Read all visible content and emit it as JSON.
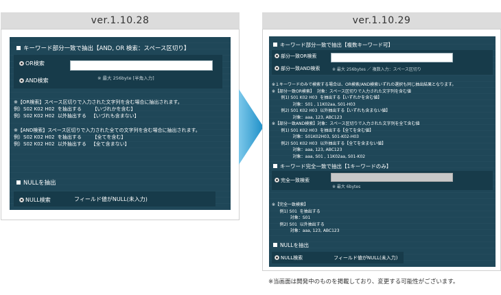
{
  "left": {
    "version": "ver.1.10.28",
    "section_keyword": "キーワード部分一致で抽出【AND, OR 検索：スペース区切り】",
    "or_label": "OR検索",
    "and_label": "AND検索",
    "input_value": "",
    "hint": "※ 最大 256byte [半角入力]",
    "explain": "※【OR検索】スペース区切りで入力された文字列を含む場合に抽出されます。\n例）S02 K02 H02  を抽出する       【いづれかを含む】\n例）S02 K02 H02  以外抽出する   【いづれも含まない】\n\n※【AND検索】スペース区切りで入力された全ての文字列を含む場合に抽出されます。\n例）S02 K02 H02  を抽出する       【全てを含む】\n例）S02 K02 H02  以外抽出する   【全て含まない】",
    "section_null": "NULLを抽出",
    "null_label": "NULL検索",
    "null_desc": "フィールド値がNULL(未入力)"
  },
  "right": {
    "version": "ver.1.10.29",
    "section_partial": "キーワード部分一致で抽出【複数キーワード可】",
    "partial_or_label": "部分一致OR検索",
    "partial_and_label": "部分一致AND検索",
    "partial_input_value": "",
    "partial_hint": "※ 最大 256bytes ／ 複数入力：スペース区切り",
    "partial_explain": "※１キーワードのみで検索する場合は、OR検索/AND検索いずれの選択も同じ抽出結果となります。\n※【部分一致OR検索】  対象：スペース区切りで入力された文字列を含む値\n       例1) S01 K02 H03  を抽出する【いずれかを含む値】\n                対象：S01 , 11K02aa, S01-H03\n       例2) S01 K02 H03  以外抽出する【いずれも含まない値】\n                対象：aaa, 123, ABC123\n※【部分一致AND検索】対象：スペース区切りで入力された文字列を全て含む値\n       例1) S01 K02 H03  を抽出する【全てを含む値】\n                対象：S01K02H03, S01-K02-H03\n       例2) S01 K02 H03  以外抽出する【全てを含まない値】\n                対象：aaa, 123, ABC123\n                対象：aaa, S01 , 11K02aa, S01-K02",
    "section_exact": "キーワード完全一致で抽出【1キーワードのみ】",
    "exact_label": "完全一致検索",
    "exact_input_value": "",
    "exact_hint": "※ 最大 6bytes",
    "exact_explain": "※【完全一致検索】\n      例1) S01  を抽出する\n              対象：S01\n      例2) S01  以外抽出する\n              対象：aaa, 123, ABC123",
    "section_null": "NULLを抽出",
    "null_label": "NULL検索",
    "null_desc": "フィールド値がNULL(未入力)"
  },
  "footnote": "※当画面は開発中のものを掲載しており、変更する可能性がございます。",
  "colors": {
    "panel": "#1f4758",
    "option_box": "#173b4a",
    "arrow": "#2aa3d8",
    "header": "#dcdcdc"
  }
}
